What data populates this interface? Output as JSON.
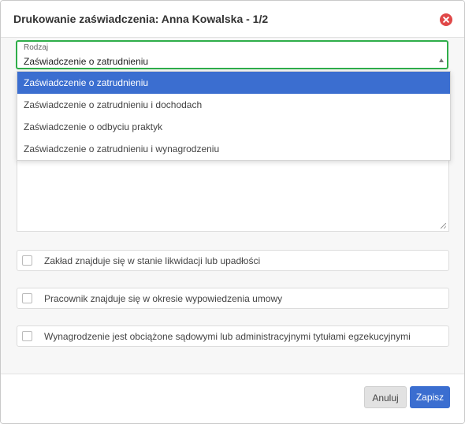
{
  "dialog": {
    "title": "Drukowanie zaświadczenia: Anna Kowalska - 1/2",
    "close_icon": "close-circle-icon"
  },
  "select": {
    "label": "Rodzaj",
    "value": "Zaświadczenie o zatrudnieniu",
    "options": [
      "Zaświadczenie o zatrudnieniu",
      "Zaświadczenie o zatrudnieniu i dochodach",
      "Zaświadczenie o odbyciu praktyk",
      "Zaświadczenie o zatrudnieniu i wynagrodzeniu"
    ]
  },
  "checkboxes": [
    {
      "label": "Zakład znajduje się w stanie likwidacji lub upadłości",
      "checked": false
    },
    {
      "label": "Pracownik znajduje się w okresie wypowiedzenia umowy",
      "checked": false
    },
    {
      "label": "Wynagrodzenie jest obciążone sądowymi lub administracyjnymi tytułami egzekucyjnymi",
      "checked": false
    }
  ],
  "footer": {
    "cancel_label": "Anuluj",
    "save_label": "Zapisz"
  },
  "colors": {
    "accent": "#3b6ed0",
    "focus_border": "#2fae4a",
    "close": "#e04848"
  }
}
